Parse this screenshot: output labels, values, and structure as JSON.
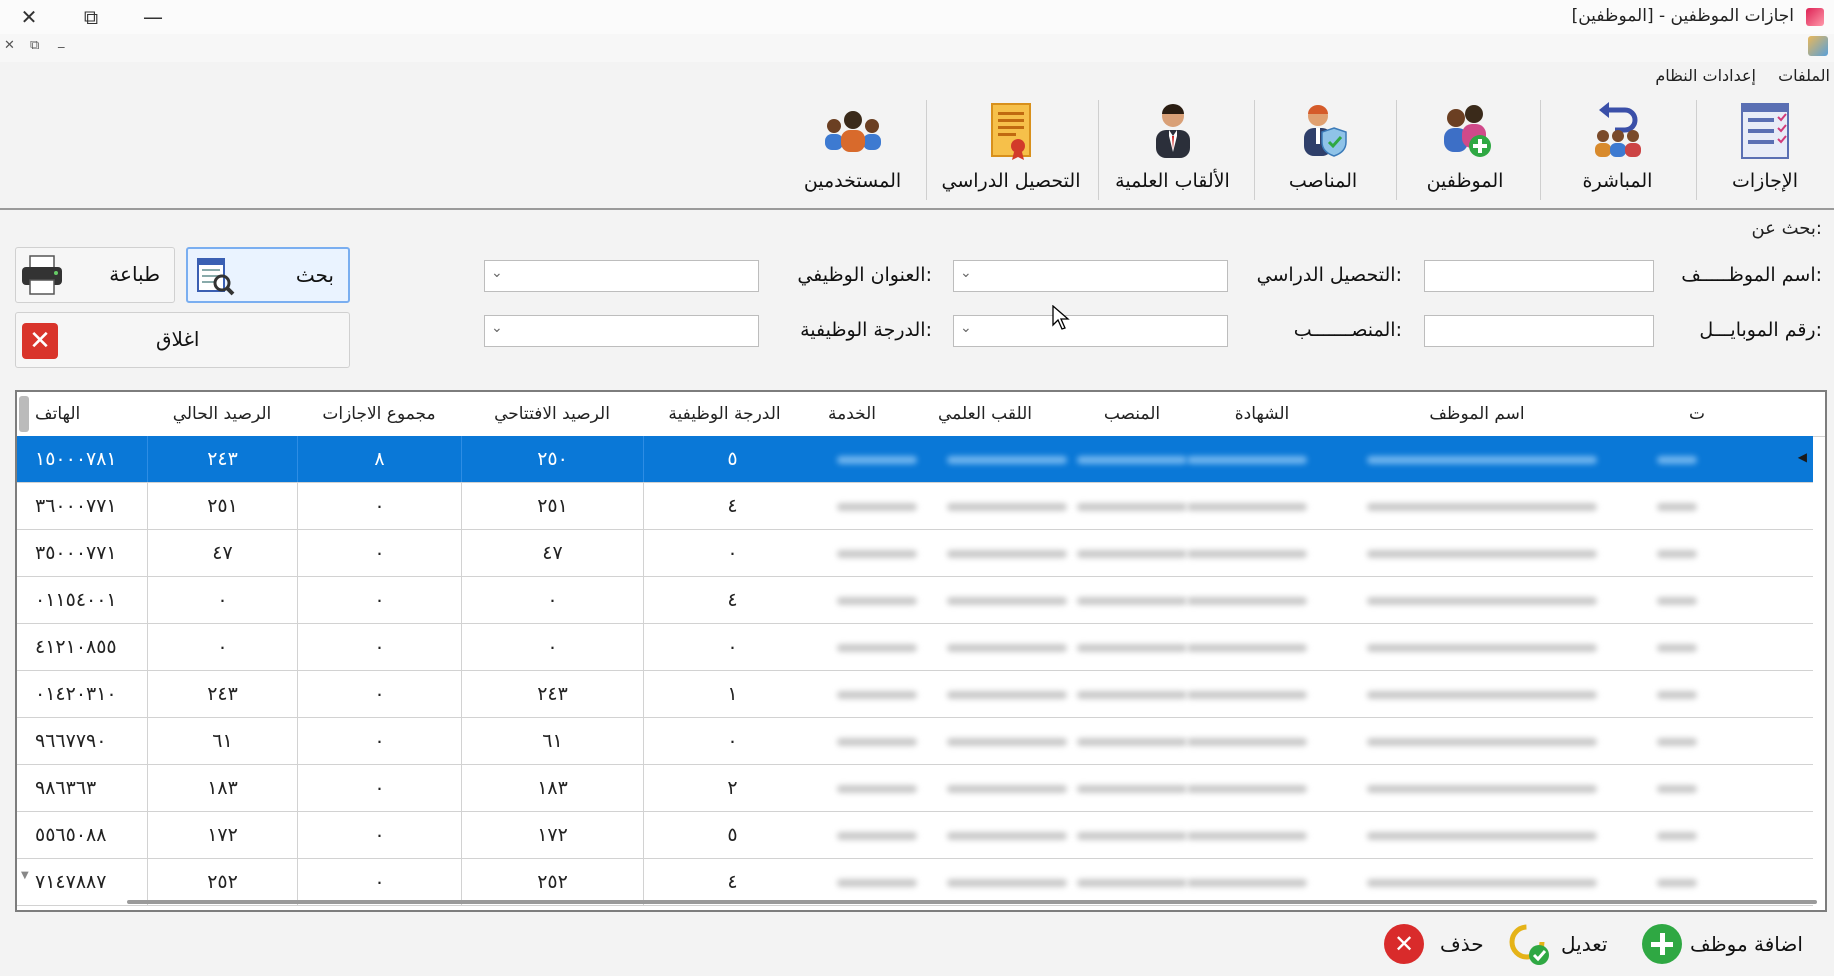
{
  "window": {
    "title": "اجازات الموظفين - [الموظفين]",
    "close_glyph": "✕",
    "restore_glyph": "⧉",
    "minimize_glyph": "—",
    "mdi_close": "✕",
    "mdi_restore": "⧉",
    "mdi_minimize": "_"
  },
  "menu": {
    "items": [
      "الملفات",
      "إعدادات النظام"
    ]
  },
  "toolbar": {
    "buttons": [
      {
        "label": "الإجازات",
        "icon": "checklist-icon"
      },
      {
        "label": "المباشرة",
        "icon": "return-people-icon"
      },
      {
        "label": "الموظفين",
        "icon": "add-employee-icon"
      },
      {
        "label": "المناصب",
        "icon": "position-shield-icon"
      },
      {
        "label": "الألقاب العلمية",
        "icon": "academic-title-icon"
      },
      {
        "label": "التحصيل الدراسي",
        "icon": "certificate-icon"
      },
      {
        "label": "المستخدمين",
        "icon": "users-group-icon"
      }
    ]
  },
  "search": {
    "title": "بحث عن:",
    "employee_name_label": "اسم الموظـــــف:",
    "mobile_label": "رقم الموبايـــل:",
    "education_label": "التحصيل الدراسي:",
    "position_label": "المنصـــــــب:",
    "job_title_label": "العنوان الوظيفي:",
    "job_grade_label": "الدرجة الوظيفية:",
    "search_button": "بحث",
    "print_button": "طباعة",
    "close_button": "اغلاق"
  },
  "grid": {
    "columns": [
      "ت",
      "اسم الموظف",
      "الشهادة",
      "المنصب",
      "اللقب العلمي",
      "الخدمة",
      "الدرجة الوظيفية",
      "الرصيد الافتتاحي",
      "مجموع الاجازات",
      "الرصيد الحالي",
      "الهاتف"
    ],
    "rows": [
      {
        "grade": "٥",
        "opening": "٢٥٠",
        "total_leaves": "٨",
        "current": "٢٤٣",
        "phone": "١٥٠٠٠٧٨١"
      },
      {
        "grade": "٤",
        "opening": "٢٥١",
        "total_leaves": "٠",
        "current": "٢٥١",
        "phone": "٣٦٠٠٠٧٧١"
      },
      {
        "grade": "٠",
        "opening": "٤٧",
        "total_leaves": "٠",
        "current": "٤٧",
        "phone": "٣٥٠٠٠٧٧١"
      },
      {
        "grade": "٤",
        "opening": "٠",
        "total_leaves": "٠",
        "current": "٠",
        "phone": "٠١١٥٤٠٠١"
      },
      {
        "grade": "٠",
        "opening": "٠",
        "total_leaves": "٠",
        "current": "٠",
        "phone": "٤١٢١٠٨٥٥"
      },
      {
        "grade": "١",
        "opening": "٢٤٣",
        "total_leaves": "٠",
        "current": "٢٤٣",
        "phone": "٠١٤٢٠٣١٠"
      },
      {
        "grade": "٠",
        "opening": "٦١",
        "total_leaves": "٠",
        "current": "٦١",
        "phone": "٩٦٦٧٧٩٠"
      },
      {
        "grade": "٢",
        "opening": "١٨٣",
        "total_leaves": "٠",
        "current": "١٨٣",
        "phone": "٩٨٦٣٦٣"
      },
      {
        "grade": "٥",
        "opening": "١٧٢",
        "total_leaves": "٠",
        "current": "١٧٢",
        "phone": "٥٥٦٥٠٨٨"
      },
      {
        "grade": "٤",
        "opening": "٢٥٢",
        "total_leaves": "٠",
        "current": "٢٥٢",
        "phone": "٧١٤٧٨٨٧"
      }
    ]
  },
  "actions": {
    "add_employee": "اضافة موظف",
    "edit": "تعديل",
    "delete": "حذف"
  },
  "colors": {
    "selection": "#0a78d7",
    "add_green": "#2fa843",
    "delete_red": "#d92b2b"
  }
}
